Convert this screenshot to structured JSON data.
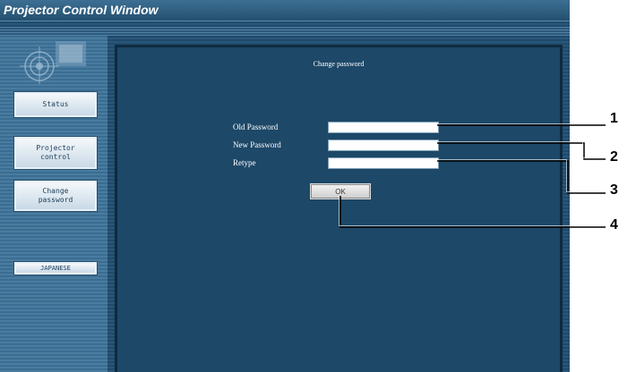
{
  "window": {
    "title": "Projector Control Window"
  },
  "sidebar": {
    "items": [
      {
        "label": "Status"
      },
      {
        "label": "Projector\ncontrol"
      },
      {
        "label": "Change\npassword"
      },
      {
        "label": "JAPANESE"
      }
    ]
  },
  "main": {
    "title": "Change password",
    "fields": [
      {
        "label": "Old Password",
        "value": ""
      },
      {
        "label": "New Password",
        "value": ""
      },
      {
        "label": "Retype",
        "value": ""
      }
    ],
    "ok_label": "OK"
  },
  "callouts": [
    "1",
    "2",
    "3",
    "4"
  ]
}
